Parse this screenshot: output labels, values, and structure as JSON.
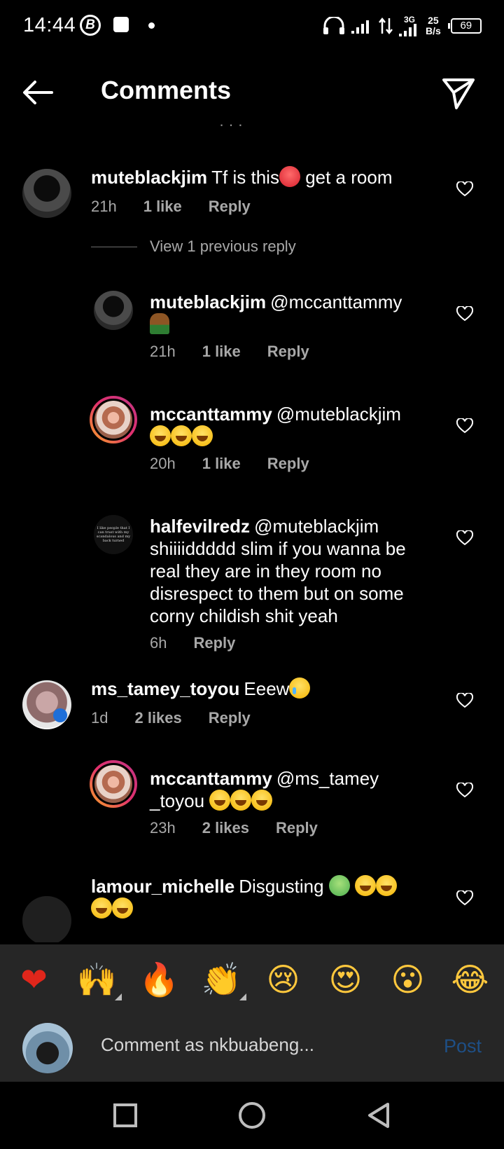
{
  "status_bar": {
    "time": "14:44",
    "b_icon": "B",
    "network": "3G",
    "speed_top": "25",
    "speed_unit": "B/s",
    "battery": "69"
  },
  "header": {
    "title": "Comments"
  },
  "comments": [
    {
      "username": "muteblackjim",
      "text": "Tf is this",
      "text_after": " get a room",
      "time": "21h",
      "likes": "1 like",
      "reply": "Reply"
    },
    {
      "view_previous": "View 1 previous reply"
    },
    {
      "username": "muteblackjim",
      "text": "@mccanttammy",
      "time": "21h",
      "likes": "1 like",
      "reply": "Reply"
    },
    {
      "username": "mccanttammy",
      "text": "@muteblackjim",
      "time": "20h",
      "likes": "1 like",
      "reply": "Reply"
    },
    {
      "username": "halfevilredz",
      "text": "@muteblackjim shiiiiddddd slim if you wanna be real they are in they room no disrespect to them but on some corny childish shit yeah",
      "avatar_text": "I like people that I can trust with my scandalous and my back turned",
      "time": "6h",
      "reply": "Reply"
    },
    {
      "username": "ms_tamey_toyou",
      "text": "Eeew",
      "time": "1d",
      "likes": "2 likes",
      "reply": "Reply"
    },
    {
      "username": "mccanttammy",
      "text": "@ms_tamey _toyou",
      "time": "23h",
      "likes": "2 likes",
      "reply": "Reply"
    },
    {
      "username": "lamour_michelle",
      "text": "Disgusting"
    }
  ],
  "emoji_bar": [
    "❤",
    "🙌",
    "🔥",
    "👏",
    "😢",
    "😍",
    "😮",
    "😂"
  ],
  "composer": {
    "placeholder": "Comment as nkbuabeng...",
    "post": "Post"
  }
}
